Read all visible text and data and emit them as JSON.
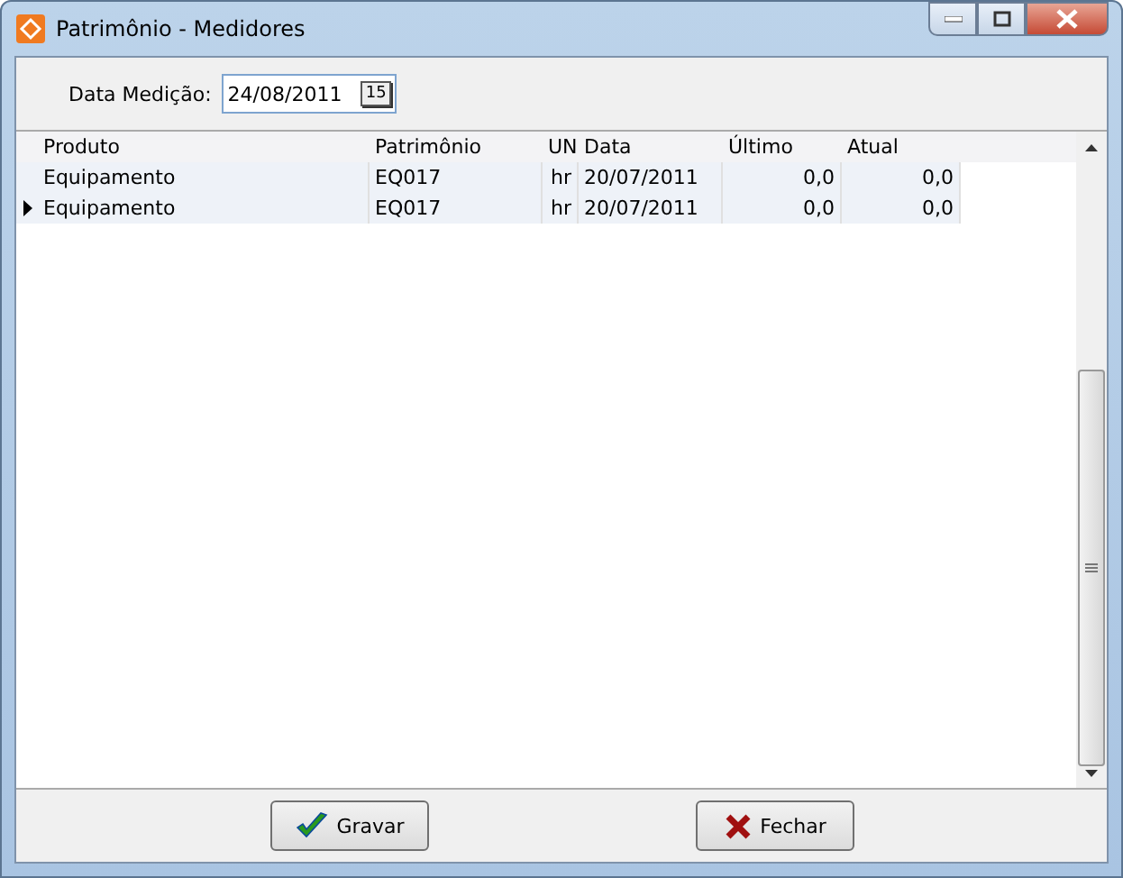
{
  "window": {
    "title": "Patrimônio - Medidores"
  },
  "date_field": {
    "label": "Data Medição:",
    "value": "24/08/2011",
    "button": "15"
  },
  "table": {
    "columns": [
      "Produto",
      "Patrimônio",
      "UN",
      "Data",
      "Último",
      "Atual"
    ],
    "rows": [
      {
        "selected": false,
        "cells": [
          "Equipamento",
          "EQ017",
          "hr",
          "20/07/2011",
          "0,0",
          "0,0"
        ]
      },
      {
        "selected": true,
        "cells": [
          "Equipamento",
          "EQ017",
          "hr",
          "20/07/2011",
          "0,0",
          "0,0"
        ]
      }
    ]
  },
  "buttons": [
    {
      "kind": "save",
      "label": "Gravar"
    },
    {
      "kind": "close",
      "label": "Fechar"
    }
  ]
}
